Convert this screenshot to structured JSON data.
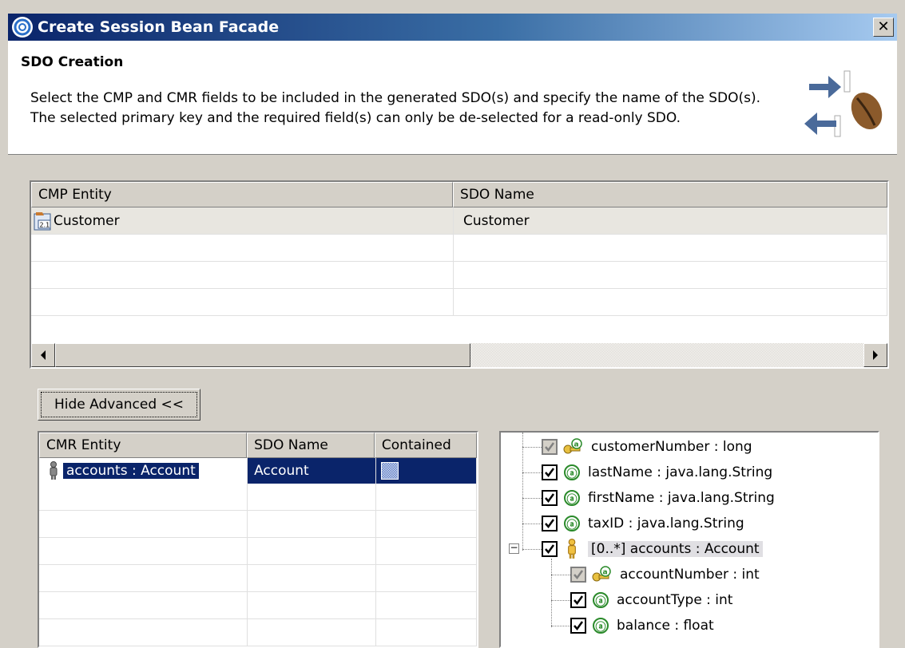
{
  "window": {
    "title": "Create Session Bean Facade"
  },
  "header": {
    "title": "SDO Creation",
    "description": "Select the CMP and CMR fields to be included in the generated SDO(s) and specify the name of the SDO(s). The selected primary key and the required field(s) can only be de-selected for a read-only SDO."
  },
  "cmp_table": {
    "columns": [
      "CMP Entity",
      "SDO Name"
    ],
    "rows": [
      {
        "entity": "Customer",
        "sdo_name": "Customer"
      }
    ]
  },
  "advanced_button": "Hide Advanced <<",
  "cmr_table": {
    "columns": [
      "CMR Entity",
      "SDO Name",
      "Contained"
    ],
    "rows": [
      {
        "entity": "accounts : Account",
        "sdo_name": "Account",
        "contained": true
      }
    ]
  },
  "fields_tree": {
    "items": [
      {
        "label": "customerNumber : long",
        "checked": true,
        "enabled": false,
        "icon": "key-attribute-icon"
      },
      {
        "label": "lastName : java.lang.String",
        "checked": true,
        "enabled": true,
        "icon": "attribute-icon"
      },
      {
        "label": "firstName : java.lang.String",
        "checked": true,
        "enabled": true,
        "icon": "attribute-icon"
      },
      {
        "label": "taxID : java.lang.String",
        "checked": true,
        "enabled": true,
        "icon": "attribute-icon"
      },
      {
        "label": "[0..*] accounts : Account",
        "checked": true,
        "enabled": true,
        "icon": "relationship-icon",
        "expanded": true,
        "children": [
          {
            "label": "accountNumber : int",
            "checked": true,
            "enabled": false,
            "icon": "key-attribute-icon"
          },
          {
            "label": "accountType : int",
            "checked": true,
            "enabled": true,
            "icon": "attribute-icon"
          },
          {
            "label": "balance : float",
            "checked": true,
            "enabled": true,
            "icon": "attribute-icon"
          }
        ]
      }
    ]
  },
  "attribute_icon_glyph": "ⓐ"
}
